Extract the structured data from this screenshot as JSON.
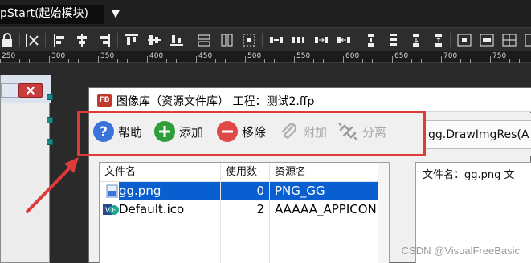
{
  "editor": {
    "file_tab": "pStart(起始模块)",
    "ruler_ticks": [
      "250",
      "300",
      "350",
      "400",
      "450",
      "500",
      "550",
      "600",
      "650",
      "700",
      "750"
    ]
  },
  "dialog": {
    "badge": "FB",
    "title": "图像库（资源文件库）  工程：测试2.ffp",
    "toolbar": {
      "help": "帮助",
      "add": "添加",
      "remove": "移除",
      "attach": "附加",
      "detach": "分离"
    },
    "code_snippet": "gg.DrawImgRes(A",
    "list": {
      "headers": [
        "文件名",
        "使用数",
        "资源名"
      ],
      "rows": [
        {
          "file": "gg.png",
          "count": "0",
          "resource": "PNG_GG",
          "selected": true
        },
        {
          "file": "Default.ico",
          "count": "2",
          "resource": "AAAAA_APPICON",
          "selected": false
        }
      ]
    },
    "preview_label": "文件名：gg.png  文"
  },
  "watermark": "CSDN @VisualFreeBasic",
  "colors": {
    "highlight": "#e03b3b",
    "selection": "#0a5fd0",
    "help_icon": "#3a74d8",
    "add_icon": "#2e9d3a",
    "remove_icon": "#e04848"
  }
}
